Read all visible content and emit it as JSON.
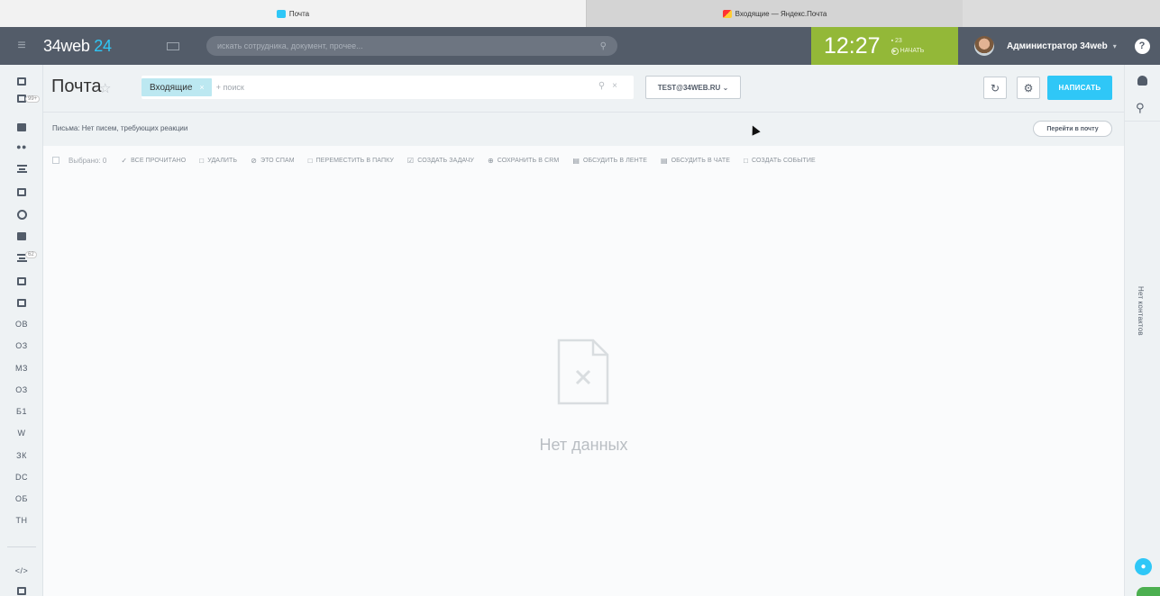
{
  "tabs": {
    "active": "Почта",
    "inactive": "Входящие — Яндекс.Почта"
  },
  "header": {
    "logo_main": "34web",
    "logo_accent": "24",
    "search_placeholder": "искать сотрудника, документ, прочее...",
    "clock_time": "12:27",
    "clock_count": "▪ 23",
    "clock_start": "НАЧАТЬ",
    "user_name": "Администратор 34web",
    "help_label": "?"
  },
  "sidebar": {
    "badges": {
      "tasks": "99+",
      "filter": "62"
    },
    "text_items": [
      "ОВ",
      "ОЗ",
      "МЗ",
      "ОЗ",
      "Б1",
      "W",
      "ЗК",
      "DC",
      "ОБ",
      "ТН"
    ],
    "code_label": "</>"
  },
  "page": {
    "title": "Почта",
    "filter_chip": "Входящие",
    "filter_hint": "+ поиск",
    "account": "TEST@34WEB.RU",
    "write_button": "НАПИСАТЬ",
    "status_text": "Письма: Нет писем, требующих реакции",
    "goto_mail": "Перейти в почту",
    "selected": "Выбрано: 0",
    "actions": [
      "ВСЕ ПРОЧИТАНО",
      "УДАЛИТЬ",
      "ЭТО СПАМ",
      "ПЕРЕМЕСТИТЬ В ПАПКУ",
      "СОЗДАТЬ ЗАДАЧУ",
      "СОХРАНИТЬ В CRM",
      "ОБСУДИТЬ В ЛЕНТЕ",
      "ОБСУДИТЬ В ЧАТЕ",
      "СОЗДАТЬ СОБЫТИЕ"
    ],
    "empty_text": "Нет данных"
  },
  "rightpanel": {
    "vertical_text": "Нет контактов"
  },
  "colors": {
    "header_bg": "#535c69",
    "accent_blue": "#2fc7f7",
    "clock_green": "#93b838",
    "chip_bg": "#bce8f1"
  },
  "icons": {
    "actions": [
      "check-icon",
      "trash-icon",
      "spam-icon",
      "folder-icon",
      "task-icon",
      "crm-icon",
      "feed-icon",
      "chat-icon",
      "calendar-icon"
    ]
  }
}
